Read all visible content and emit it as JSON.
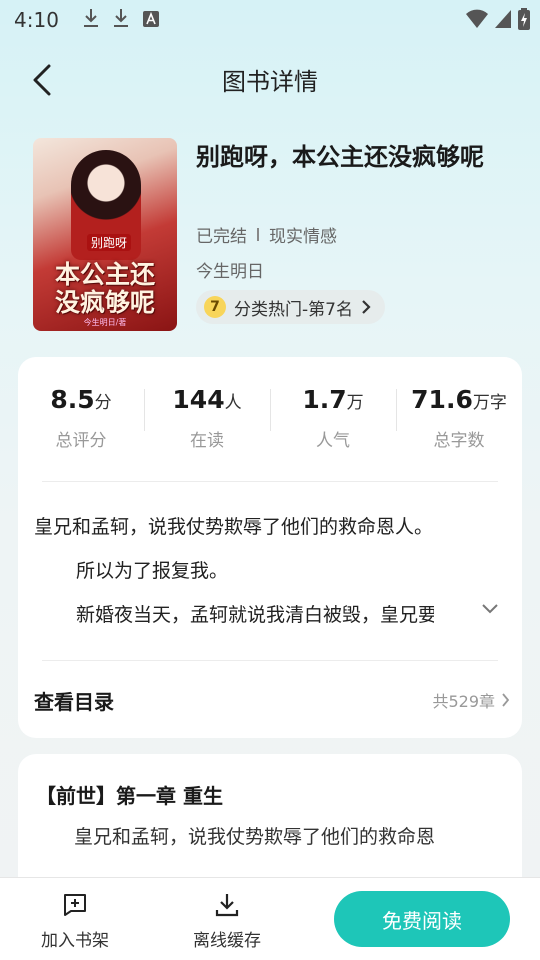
{
  "status_bar": {
    "time": "4:10"
  },
  "header": {
    "title": "图书详情"
  },
  "book": {
    "title": "别跑呀，本公主还没疯够呢",
    "status": "已完结",
    "category": "现实情感",
    "author": "今生明日",
    "rank_number": "7",
    "rank_label": "分类热门-第7名",
    "cover": {
      "subtitle": "别跑呀",
      "title_line1": "本公主还",
      "title_line2": "没疯够呢",
      "author": "今生明日/著"
    }
  },
  "stats": [
    {
      "value": "8.5",
      "unit": "分",
      "label": "总评分"
    },
    {
      "value": "144",
      "unit": "人",
      "label": "在读"
    },
    {
      "value": "1.7",
      "unit": "万",
      "label": "人气"
    },
    {
      "value": "71.6",
      "unit": "万字",
      "label": "总字数"
    }
  ],
  "description": {
    "line1": "皇兄和孟轲，说我仗势欺辱了他们的救命恩人。",
    "line2": "所以为了报复我。",
    "line3": "新婚夜当天，孟轲就说我清白被毁，皇兄要"
  },
  "toc": {
    "title": "查看目录",
    "count": "共529章"
  },
  "first_chapter": {
    "title": "【前世】第一章 重生",
    "text": "皇兄和孟轲，说我仗势欺辱了他们的救命恩"
  },
  "bottom_bar": {
    "shelf_label": "加入书架",
    "offline_label": "离线缓存",
    "read_label": "免费阅读"
  },
  "colors": {
    "accent": "#1ec6b8",
    "rank_badge": "#f8d55a"
  }
}
